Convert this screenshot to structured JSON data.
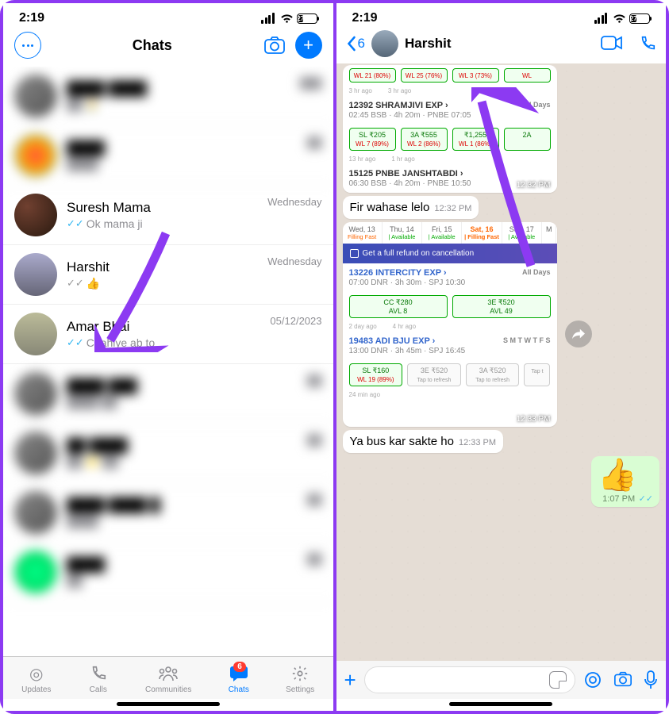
{
  "status": {
    "time": "2:19",
    "battery": "27"
  },
  "left": {
    "header": {
      "title": "Chats"
    },
    "chats": [
      {
        "name": "Suresh Mama",
        "msg": "Ok mama ji",
        "date": "Wednesday",
        "checks": "blue"
      },
      {
        "name": "Harshit",
        "msg": "👍",
        "date": "Wednesday",
        "checks": "grey"
      },
      {
        "name": "Amar Bhai",
        "msg": "Chahiye ab to",
        "date": "05/12/2023",
        "checks": "blue"
      }
    ],
    "nav": {
      "updates": "Updates",
      "calls": "Calls",
      "communities": "Communities",
      "chats": "Chats",
      "settings": "Settings",
      "badge": "6"
    }
  },
  "right": {
    "header": {
      "back_count": "6",
      "name": "Harshit"
    },
    "train1": {
      "chips": [
        {
          "t": "WL 21 (80%)"
        },
        {
          "t": "WL 25 (76%)"
        },
        {
          "t": "WL 3 (73%)"
        },
        {
          "t": "WL"
        }
      ],
      "t1_ago": "3 hr ago",
      "t1b_ago": "3 hr ago",
      "title": "12392 SHRAMJIVI EXP ›",
      "sub": "02:45 BSB · 4h 20m · PNBE 07:05",
      "alldays": "All Days",
      "chips2": [
        {
          "t": "SL ₹205",
          "w": "WL 7 (89%)"
        },
        {
          "t": "3A ₹555",
          "w": "WL 2 (86%)"
        },
        {
          "t": "₹1,255",
          "w": "WL 1 (86%)"
        },
        {
          "t": "2A",
          "w": ""
        }
      ],
      "ago2": "13 hr ago",
      "ago2b": "1 hr ago",
      "title2": "15125 PNBE JANSHTABDI ›",
      "sub2": "06:30 BSB · 4h 20m · PNBE 10:50",
      "time": "12:32 PM"
    },
    "msg1": {
      "text": "Fir wahase lelo",
      "time": "12:32 PM"
    },
    "train2": {
      "dates": [
        {
          "d": "Wed, 13",
          "s": "Filling Fast"
        },
        {
          "d": "Thu, 14",
          "s": "| Available"
        },
        {
          "d": "Fri, 15",
          "s": "| Available"
        },
        {
          "d": "Sat, 16",
          "s": "| Filling Fast",
          "sel": true
        },
        {
          "d": "Sun, 17",
          "s": "| Available"
        },
        {
          "d": "M",
          "s": ""
        }
      ],
      "refund": "Get a full refund on cancellation",
      "t1": "13226 INTERCITY EXP ›",
      "t1sub": "07:00 DNR · 3h 30m · SPJ 10:30",
      "t1days": "All Days",
      "t1chips": [
        {
          "t": "CC ₹280",
          "w": "AVL 8"
        },
        {
          "t": "3E ₹520",
          "w": "AVL 49"
        }
      ],
      "t1ago": "2 day ago",
      "t1agob": "4 hr ago",
      "t2": "19483 ADI BJU EXP ›",
      "t2sub": "13:00 DNR · 3h 45m · SPJ 16:45",
      "t2days": "S M T W T F S",
      "t2chips": [
        {
          "t": "SL ₹160",
          "w": "WL 19 (89%)"
        },
        {
          "t": "3E ₹520",
          "w": "Tap to refresh"
        },
        {
          "t": "3A ₹520",
          "w": "Tap to refresh"
        },
        {
          "t": "",
          "w": "Tap t"
        }
      ],
      "t2ago": "24 min ago",
      "time": "12:33 PM"
    },
    "msg2": {
      "text": "Ya bus kar sakte ho",
      "time": "12:33 PM"
    },
    "emoji_msg": {
      "emoji": "👍",
      "time": "1:07 PM"
    }
  }
}
